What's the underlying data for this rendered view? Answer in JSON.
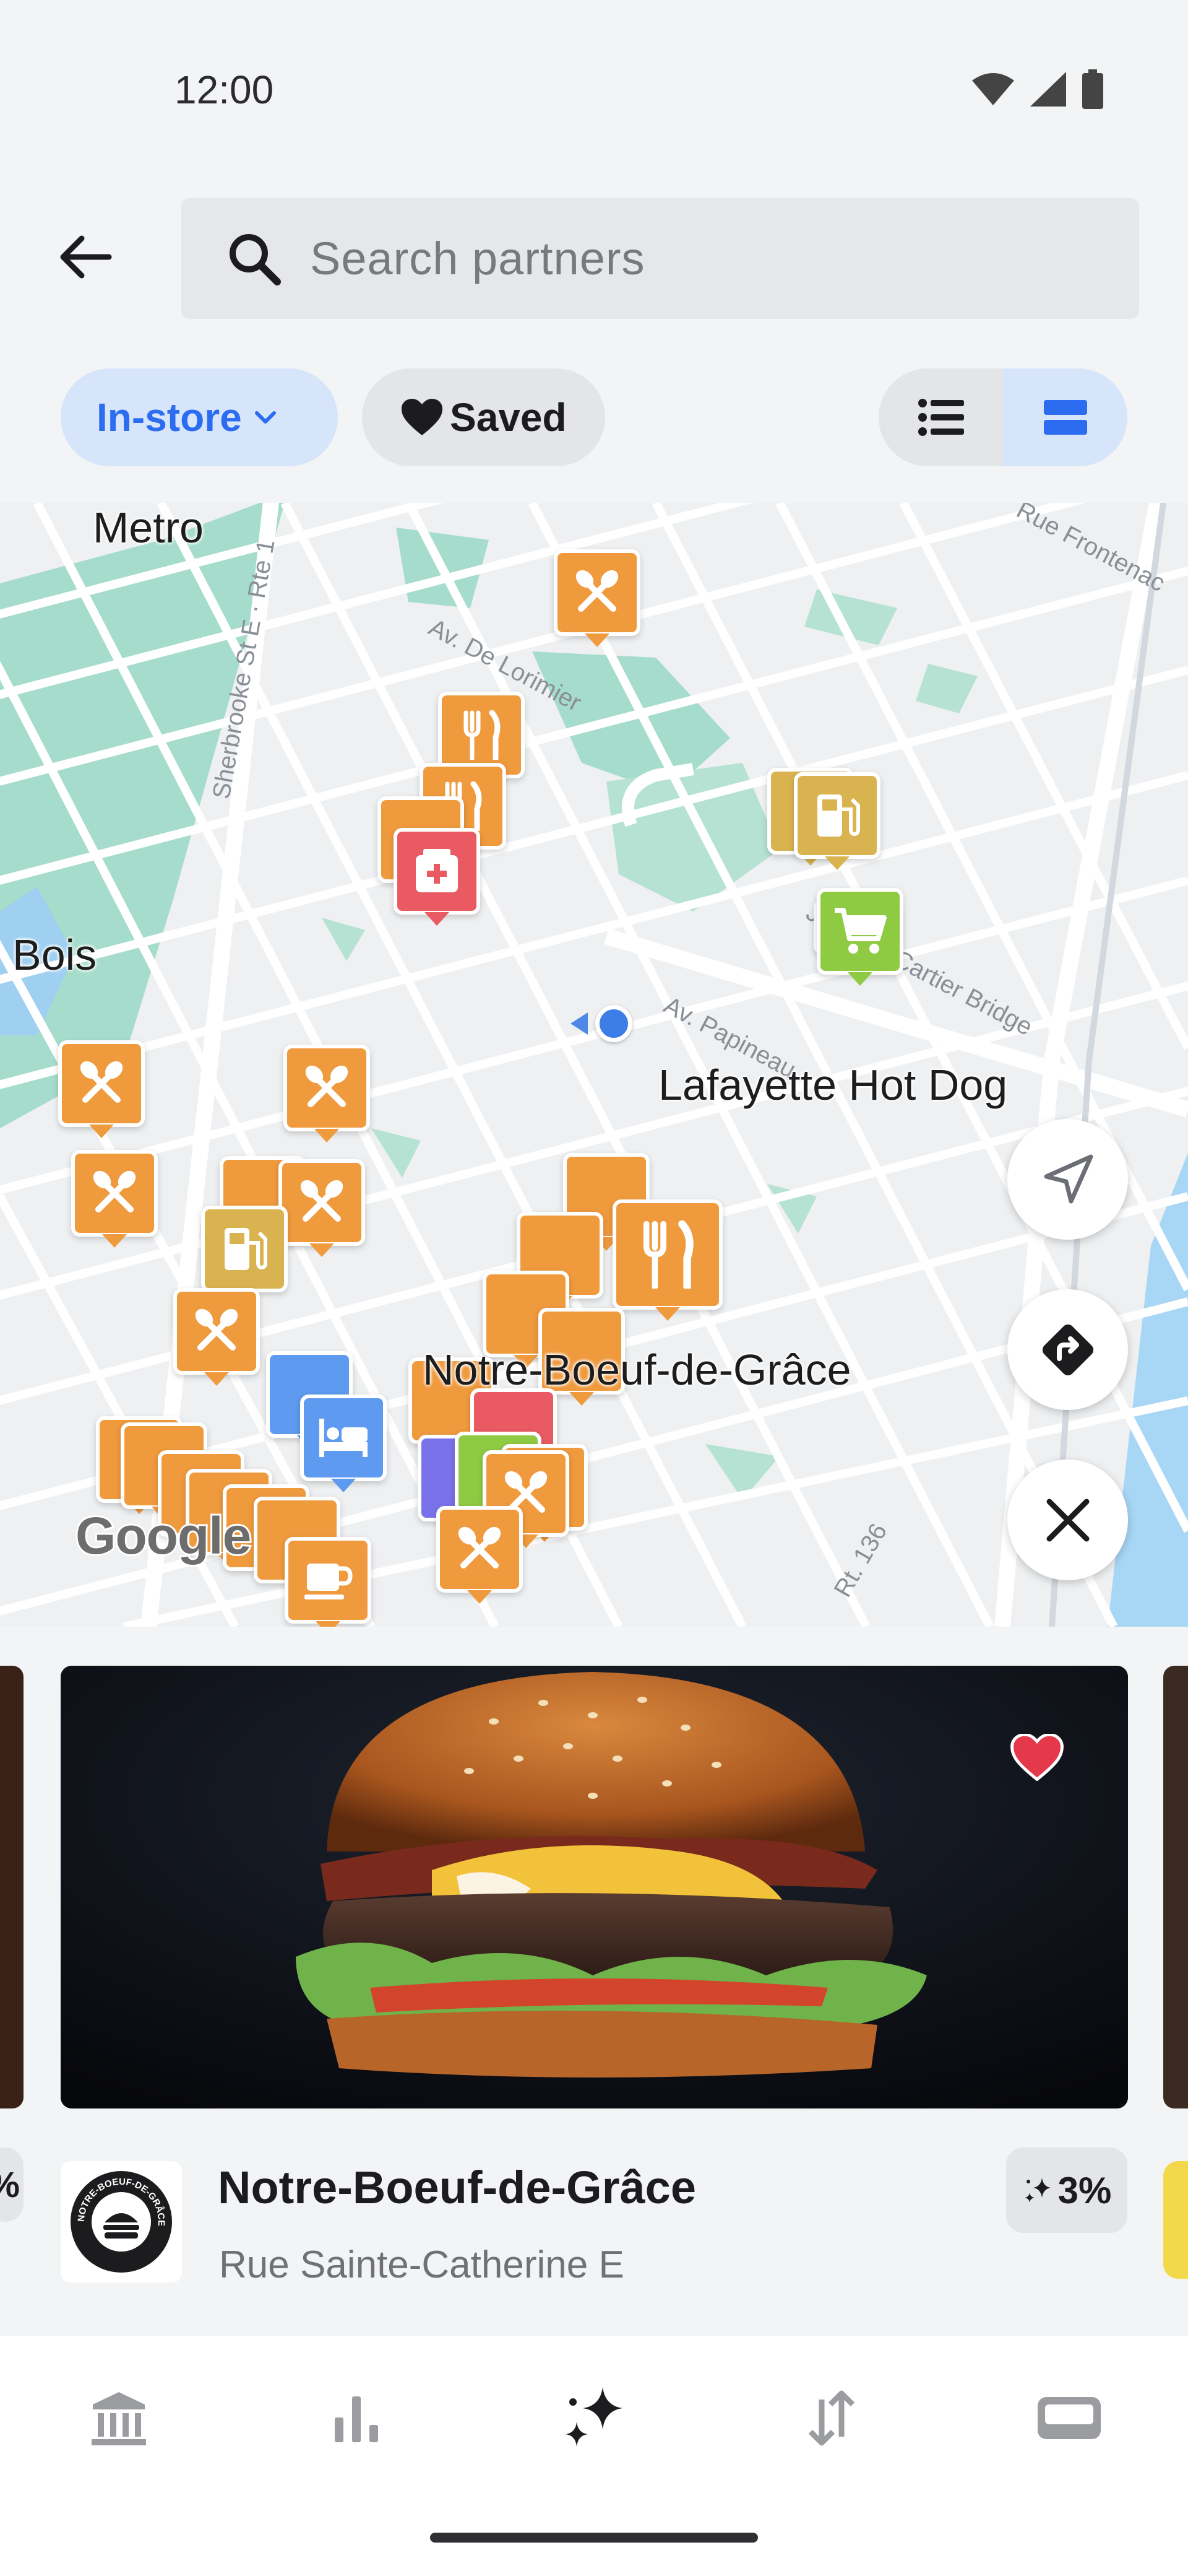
{
  "status_bar": {
    "time": "12:00",
    "icons": [
      "wifi-icon",
      "cellular-icon",
      "battery-icon"
    ]
  },
  "search": {
    "placeholder": "Search partners",
    "value": ""
  },
  "filters": {
    "in_store_label": "In-store",
    "saved_label": "Saved",
    "view_modes": [
      "list",
      "map"
    ],
    "active_view": "map"
  },
  "map": {
    "labels": {
      "metro": "Metro",
      "bois": "Bois",
      "lafayette": "Lafayette Hot Dog",
      "notre_boeuf": "Notre-Boeuf-de-Grâce"
    },
    "street_labels": {
      "sherbrooke": "Sherbrooke St E · Rte 1",
      "de_lorimier": "Av. De Lorimier",
      "papineau": "Av. Papineau",
      "jacques_cartier": "Jacques Cartier Bridge",
      "frontenac": "Rue Frontenac",
      "rt136": "Rt. 136"
    },
    "attribution": "Google",
    "pin_categories": [
      "restaurant",
      "pharmacy",
      "gas-station",
      "grocery",
      "hotel",
      "cafe"
    ],
    "colors": {
      "restaurant": "#f09a3e",
      "pharmacy": "#e95a62",
      "grocery": "#8fca43",
      "gas": "#d9b34f",
      "hotel": "#5d9af0",
      "water": "#9fcff1",
      "park": "#a6dccb"
    }
  },
  "card": {
    "name": "Notre-Boeuf-de-Grâce",
    "address": "Rue Sainte-Catherine E",
    "cashback": "3%",
    "logo_text": "NOTRE-BOEUF-DE-GRÂCE",
    "saved": true
  },
  "side_card_left_chip": "%",
  "bottom_nav": [
    "bank-icon",
    "insights-icon",
    "rewards-icon",
    "transfers-icon",
    "card-icon"
  ],
  "active_nav": "rewards-icon",
  "accent": "#2c6cf0"
}
